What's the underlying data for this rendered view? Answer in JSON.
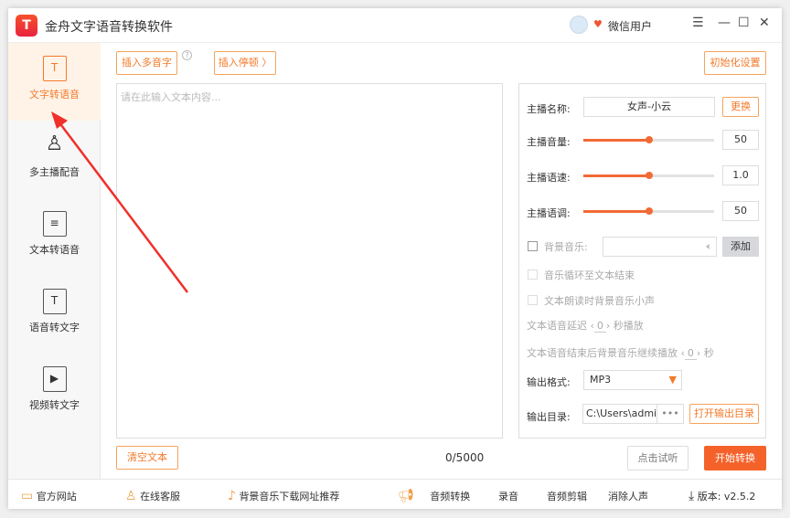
{
  "app": {
    "title": "金舟文字语音转换软件",
    "user": "微信用户",
    "logo_text": "T"
  },
  "sidebar": {
    "items": [
      {
        "label": "文字转语音",
        "icon": "text-to-speech-icon",
        "glyph": "T"
      },
      {
        "label": "多主播配音",
        "icon": "user-add-icon",
        "glyph": "♙"
      },
      {
        "label": "文本转语音",
        "icon": "document-icon",
        "glyph": "≡"
      },
      {
        "label": "语音转文字",
        "icon": "speech-to-text-icon",
        "glyph": "T"
      },
      {
        "label": "视频转文字",
        "icon": "video-icon",
        "glyph": "▶"
      }
    ]
  },
  "toolbar": {
    "insert_polyphone": "插入多音字",
    "help": "?",
    "insert_pause": "插入停顿 〉",
    "init_settings": "初始化设置"
  },
  "editor": {
    "placeholder": "请在此输入文本内容...",
    "clear": "清空文本",
    "count": "0/5000"
  },
  "settings": {
    "anchor_label": "主播名称:",
    "anchor_value": "女声-小云",
    "change": "更换",
    "volume_label": "主播音量:",
    "volume": "50",
    "volume_pct": 50,
    "speed_label": "主播语速:",
    "speed": "1.0",
    "speed_pct": 50,
    "pitch_label": "主播语调:",
    "pitch": "50",
    "pitch_pct": 50,
    "bgm_label": "背景音乐:",
    "add": "添加",
    "loop_label": "音乐循环至文本结束",
    "quiet_label": "文本朗读时背景音乐小声",
    "delay_prefix": "文本语音延迟",
    "delay_value": "0",
    "delay_suffix": "秒播放",
    "after_prefix": "文本语音结束后背景音乐继续播放",
    "after_value": "0",
    "after_suffix": "秒",
    "format_label": "输出格式:",
    "format": "MP3",
    "dir_label": "输出目录:",
    "dir": "C:\\Users\\admir",
    "dir_more": "•••",
    "open_dir": "打开输出目录"
  },
  "actions": {
    "preview": "点击试听",
    "start": "开始转换"
  },
  "footer": {
    "site": "官方网站",
    "service": "在线客服",
    "bgm_sites": "背景音乐下载网址推荐",
    "audio_convert": "音频转换",
    "record": "录音",
    "audio_edit": "音频剪辑",
    "remove_vocal": "消除人声",
    "version": "版本: v2.5.2"
  },
  "colors": {
    "accent": "#f37a2a",
    "start": "#f4622a",
    "arrow": "#f0302a"
  }
}
